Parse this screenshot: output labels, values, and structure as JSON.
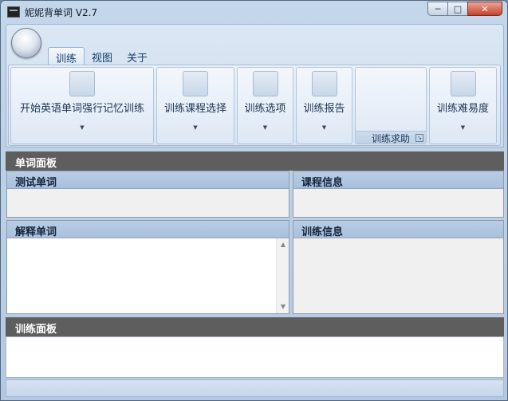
{
  "window": {
    "title": "妮妮背单词 V2.7"
  },
  "window_controls": {
    "minimize": "─",
    "maximize": "□",
    "close": "✕"
  },
  "tabs": [
    {
      "label": "训练",
      "active": true
    },
    {
      "label": "视图",
      "active": false
    },
    {
      "label": "关于",
      "active": false
    }
  ],
  "ribbon": {
    "buttons": [
      {
        "label": "开始英语单词强行记忆训练"
      },
      {
        "label": "训练课程选择"
      },
      {
        "label": "训练选项"
      },
      {
        "label": "训练报告"
      },
      {
        "label": "训练难易度"
      }
    ],
    "help_group_label": "训练求助",
    "dropdown_arrow": "▼",
    "launcher_glyph": "↘"
  },
  "word_panel": {
    "title": "单词面板",
    "test_word_header": "测试单词",
    "course_info_header": "课程信息",
    "explain_word_header": "解释单词",
    "train_info_header": "训练信息"
  },
  "train_panel": {
    "title": "训练面板"
  },
  "scroll": {
    "up": "▲",
    "down": "▼"
  },
  "colors": {
    "section_header": "#5e5e5e",
    "panel_header": "#b9cde4",
    "ribbon": "#dbe7f4"
  }
}
